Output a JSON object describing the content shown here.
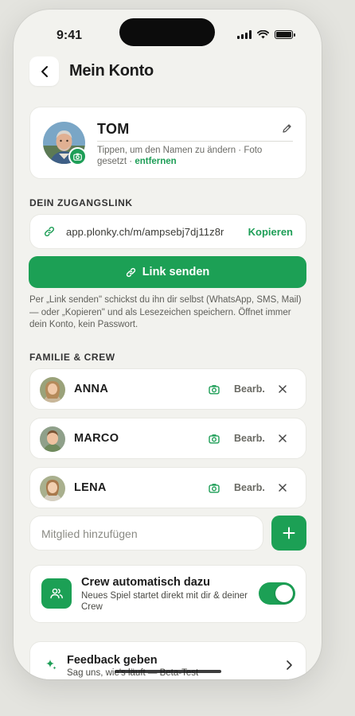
{
  "status": {
    "time": "9:41"
  },
  "header": {
    "title": "Mein Konto"
  },
  "profile": {
    "name": "TOM",
    "hint": "Tippen, um den Namen zu ändern · Foto gesetzt · ",
    "remove_label": "entfernen"
  },
  "access": {
    "section_label": "DEIN ZUGANGSLINK",
    "url": "app.plonky.ch/m/ampsebj7dj11z8r",
    "copy_label": "Kopieren",
    "send_label": "Link senden",
    "help": "Per „Link senden\" schickst du ihn dir selbst (WhatsApp, SMS, Mail) — oder „Kopieren\" und als Lesezeichen speichern. Öffnet immer dein Konto, kein Passwort."
  },
  "crew_section": {
    "section_label": "FAMILIE & CREW",
    "members": [
      {
        "name": "ANNA",
        "edit_label": "Bearb."
      },
      {
        "name": "MARCO",
        "edit_label": "Bearb."
      },
      {
        "name": "LENA",
        "edit_label": "Bearb."
      }
    ],
    "add_placeholder": "Mitglied hinzufügen"
  },
  "auto_crew": {
    "title": "Crew automatisch dazu",
    "subtitle": "Neues Spiel startet direkt mit dir & deiner Crew",
    "enabled": true
  },
  "feedback": {
    "title": "Feedback geben",
    "subtitle": "Sag uns, wie's läuft — Beta-Test"
  },
  "colors": {
    "accent": "#1ca055",
    "background": "#f2f2ee"
  },
  "icons": [
    "back-chevron-icon",
    "pencil-icon",
    "camera-icon",
    "link-icon",
    "close-icon",
    "plus-icon",
    "crew-icon",
    "sparkle-icon",
    "chevron-right-icon"
  ]
}
